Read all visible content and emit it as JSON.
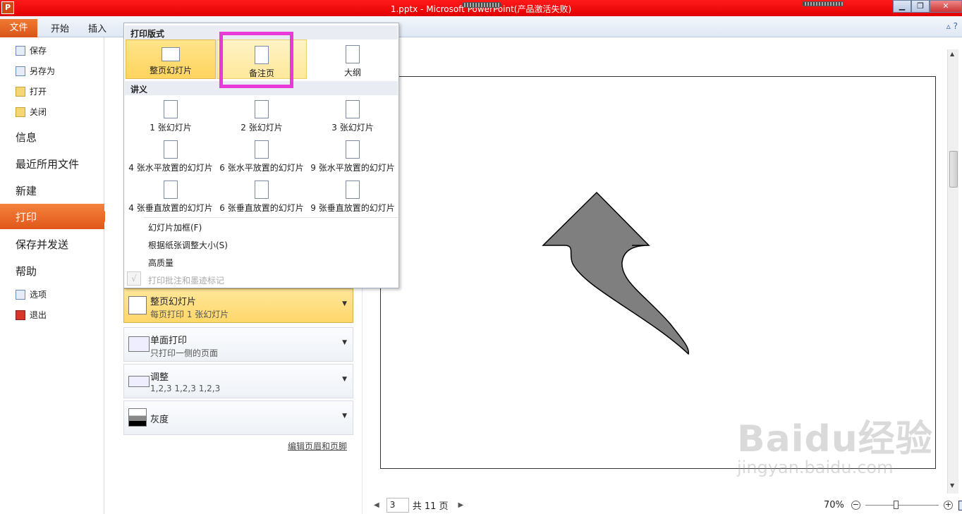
{
  "window": {
    "title": "1.pptx - Microsoft PowerPoint(产品激活失败)",
    "app_icon": "P",
    "min": "▁",
    "max": "❐",
    "close": "✕"
  },
  "ribbon": {
    "file": "文件",
    "tabs": [
      "开始",
      "插入"
    ],
    "help": "▵ ?"
  },
  "nav": {
    "save": "保存",
    "save_as": "另存为",
    "open": "打开",
    "close": "关闭",
    "info": "信息",
    "recent": "最近所用文件",
    "new": "新建",
    "print": "打印",
    "save_send": "保存并发送",
    "help": "帮助",
    "options": "选项",
    "exit": "退出"
  },
  "menu": {
    "print_layout_header": "打印版式",
    "layouts": [
      "整页幻灯片",
      "备注页",
      "大纲"
    ],
    "handouts_header": "讲义",
    "handouts": [
      "1 张幻灯片",
      "2 张幻灯片",
      "3 张幻灯片",
      "4 张水平放置的幻灯片",
      "6 张水平放置的幻灯片",
      "9 张水平放置的幻灯片",
      "4 张垂直放置的幻灯片",
      "6 张垂直放置的幻灯片",
      "9 张垂直放置的幻灯片"
    ],
    "options": [
      "幻灯片加框(F)",
      "根据纸张调整大小(S)",
      "高质量",
      "打印批注和墨迹标记"
    ],
    "checkmark": "√"
  },
  "settings": {
    "layout": {
      "title": "整页幻灯片",
      "sub": "每页打印 1 张幻灯片"
    },
    "sides": {
      "title": "单面打印",
      "sub": "只打印一侧的页面"
    },
    "collate": {
      "title": "调整",
      "sub": "1,2,3    1,2,3    1,2,3"
    },
    "color": {
      "title": "灰度"
    },
    "edit_link": "编辑页眉和页脚",
    "dropdown_arrow": "▼"
  },
  "pager": {
    "prev": "◀",
    "page": "3",
    "total": "共 11 页",
    "next": "▶"
  },
  "zoom": {
    "level": "70%",
    "minus": "−",
    "plus": "+"
  },
  "scroll": {
    "up": "▲",
    "down": "▼"
  },
  "watermark": {
    "brand": "Baidu经验",
    "url": "jingyan.baidu.com"
  },
  "colors": {
    "accent_orange": "#e96a2c",
    "title_red": "#e00000",
    "highlight_magenta": "#e93ad9",
    "arrow_fill": "#7f7f7f"
  }
}
